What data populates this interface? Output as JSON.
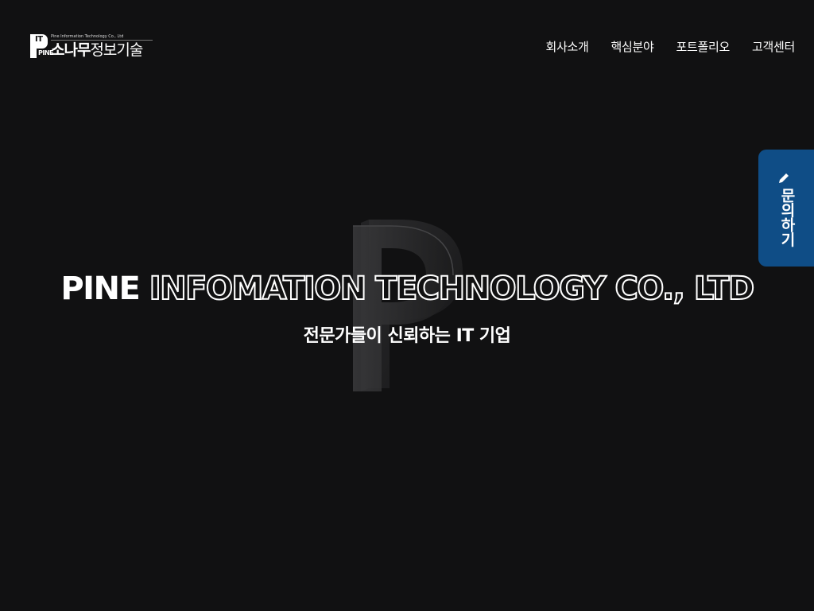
{
  "header": {
    "logo": {
      "mark_it": "IT",
      "mark_pine": "PINE",
      "company_en": "Pine Information Technology Co., Ltd",
      "company_ko_bold": "소나무",
      "company_ko_light": "정보기술"
    },
    "nav": [
      {
        "label": "회사소개"
      },
      {
        "label": "핵심분야"
      },
      {
        "label": "포트폴리오"
      },
      {
        "label": "고객센터"
      }
    ]
  },
  "hero": {
    "title_solid": "PINE",
    "title_outline": "INFOMATION TECHNOLOGY CO., LTD",
    "subtitle": "전문가들이 신뢰하는 IT 기업"
  },
  "side_tab": {
    "label": "문의하기",
    "icon": "pencil-icon",
    "color": "#0f4d86"
  },
  "colors": {
    "background": "#111112",
    "text": "#ffffff",
    "accent": "#0f4d86"
  }
}
